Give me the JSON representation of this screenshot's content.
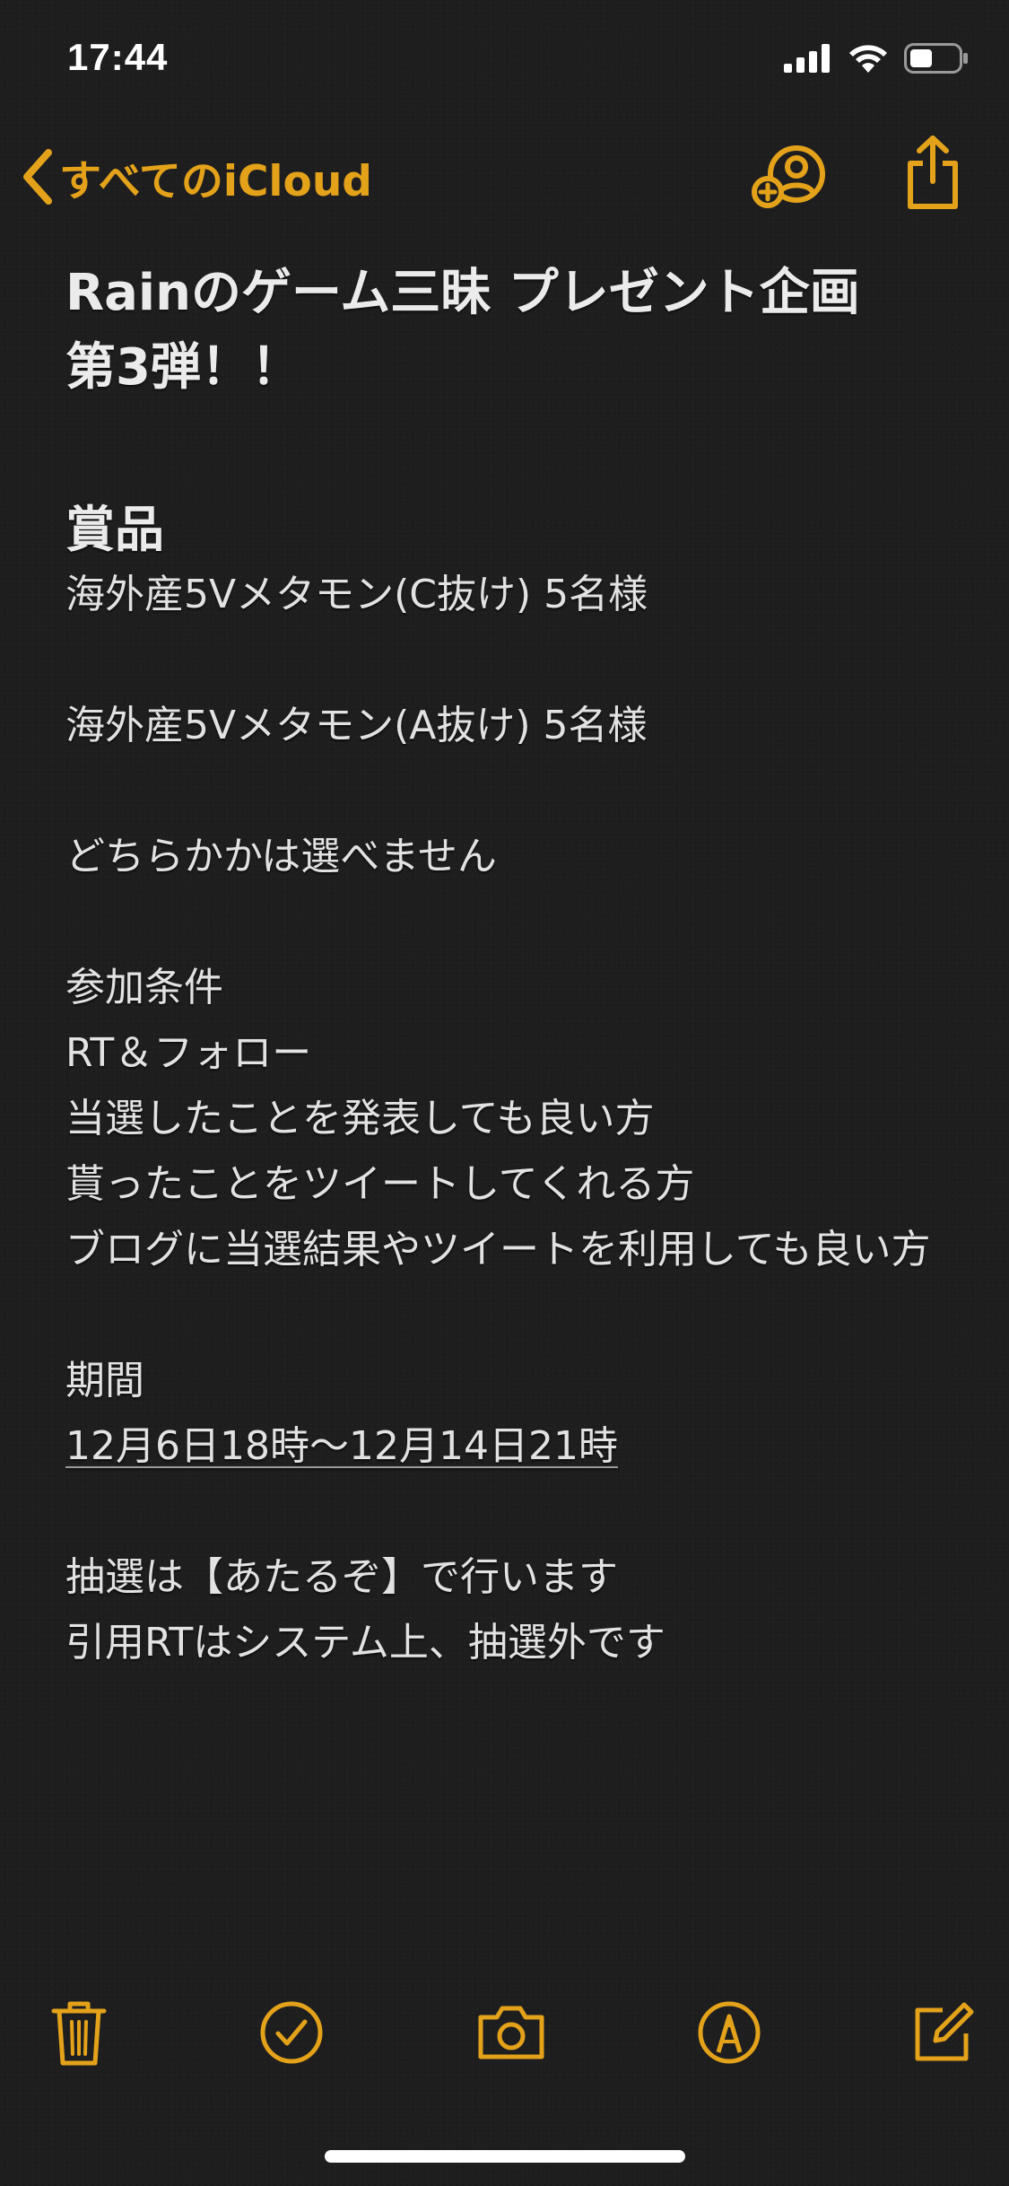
{
  "status_bar": {
    "time": "17:44"
  },
  "nav": {
    "back_label": "すべてのiCloud",
    "icons": [
      "add-person-icon",
      "share-icon"
    ]
  },
  "note": {
    "title_line1": "Rainのゲーム三昧 プレゼント企画",
    "title_line2": "第3弾！！",
    "prize_heading": "賞品",
    "prize_1": "海外産5Vメタモン(C抜け) 5名様",
    "prize_2": "海外産5Vメタモン(A抜け) 5名様",
    "prize_note": "どちらかかは選べません",
    "conditions_heading": "参加条件",
    "conditions": [
      "RT＆フォロー",
      "当選したことを発表しても良い方",
      "貰ったことをツイートしてくれる方",
      "ブログに当選結果やツイートを利用しても良い方"
    ],
    "period_heading": "期間",
    "period": "12月6日18時〜12月14日21時",
    "lottery_1": "抽選は【あたるぞ】で行います",
    "lottery_2": "引用RTはシステム上、抽選外です"
  },
  "toolbar": {
    "icons": [
      "trash-icon",
      "checklist-icon",
      "camera-icon",
      "markup-icon",
      "compose-icon"
    ]
  },
  "colors": {
    "accent": "#e3a21a",
    "background": "#1e1e1f",
    "text": "#e6e6e6"
  }
}
